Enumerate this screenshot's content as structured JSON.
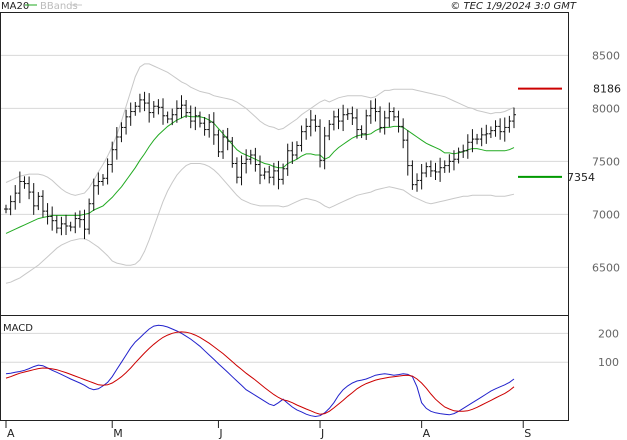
{
  "header": {
    "legend_ma": "MA20",
    "legend_bands": "BBands",
    "timestamp": "© TEC 1/9/2024 3:0 GMT"
  },
  "colors": {
    "ma": "#22aa22",
    "bands": "#c8c8c8",
    "bars": "#111111",
    "resistance": "#cc0000",
    "support": "#009900",
    "macd": "#2222cc",
    "signal": "#cc0000",
    "grid": "#d8d8d8"
  },
  "chart_data": [
    {
      "type": "ohlc",
      "ylim": [
        6050,
        8900
      ],
      "yticks": [
        6500,
        7000,
        7500,
        8000,
        8500
      ],
      "ytick_labels": [
        "6500",
        "7000",
        "7500",
        "8000",
        "8500"
      ],
      "months": [
        "A",
        "M",
        "J",
        "J",
        "A",
        "S"
      ],
      "month_index": [
        0,
        23,
        46,
        68,
        90,
        112
      ],
      "resistance": {
        "value": 8186,
        "label": "8186"
      },
      "support": {
        "value": 7354,
        "label": "7354"
      },
      "close": [
        7050,
        7120,
        7200,
        7310,
        7290,
        7210,
        7080,
        7170,
        7030,
        6980,
        6940,
        6870,
        6910,
        6890,
        6880,
        6960,
        6950,
        6860,
        7100,
        7270,
        7310,
        7340,
        7470,
        7610,
        7730,
        7820,
        7920,
        7970,
        8020,
        8080,
        8050,
        7960,
        8020,
        8010,
        7930,
        7900,
        7940,
        8000,
        8030,
        7960,
        7880,
        7930,
        7860,
        7800,
        7870,
        7750,
        7590,
        7730,
        7690,
        7480,
        7350,
        7480,
        7520,
        7560,
        7470,
        7370,
        7400,
        7350,
        7410,
        7330,
        7430,
        7600,
        7560,
        7650,
        7780,
        7830,
        7890,
        7830,
        7510,
        7740,
        7850,
        7920,
        7880,
        7940,
        7950,
        7910,
        7800,
        7760,
        7930,
        8000,
        7970,
        7820,
        7910,
        7970,
        7920,
        7830,
        7700,
        7460,
        7280,
        7320,
        7390,
        7450,
        7410,
        7400,
        7440,
        7460,
        7500,
        7520,
        7590,
        7600,
        7680,
        7710,
        7710,
        7750,
        7760,
        7790,
        7830,
        7780,
        7820,
        7880,
        7940
      ],
      "ma20": [
        6820,
        6840,
        6860,
        6880,
        6900,
        6920,
        6940,
        6960,
        6970,
        6980,
        6990,
        6990,
        6990,
        6990,
        6990,
        6990,
        6990,
        7000,
        7010,
        7040,
        7060,
        7080,
        7120,
        7160,
        7210,
        7260,
        7320,
        7380,
        7440,
        7510,
        7570,
        7640,
        7700,
        7750,
        7790,
        7830,
        7860,
        7890,
        7910,
        7930,
        7920,
        7920,
        7920,
        7910,
        7890,
        7860,
        7810,
        7760,
        7710,
        7660,
        7610,
        7580,
        7560,
        7540,
        7520,
        7500,
        7480,
        7470,
        7450,
        7440,
        7440,
        7480,
        7500,
        7520,
        7550,
        7570,
        7570,
        7560,
        7560,
        7520,
        7540,
        7590,
        7630,
        7660,
        7690,
        7720,
        7740,
        7750,
        7750,
        7760,
        7790,
        7810,
        7820,
        7820,
        7830,
        7830,
        7820,
        7790,
        7760,
        7730,
        7700,
        7670,
        7650,
        7630,
        7610,
        7580,
        7580,
        7570,
        7580,
        7590,
        7610,
        7620,
        7620,
        7610,
        7600,
        7600,
        7600,
        7600,
        7600,
        7610,
        7630
      ],
      "upper_band": [
        7300,
        7320,
        7340,
        7360,
        7370,
        7380,
        7380,
        7380,
        7370,
        7350,
        7320,
        7280,
        7240,
        7210,
        7190,
        7180,
        7190,
        7200,
        7250,
        7320,
        7400,
        7470,
        7550,
        7640,
        7750,
        7880,
        8020,
        8160,
        8300,
        8390,
        8420,
        8420,
        8400,
        8380,
        8360,
        8340,
        8310,
        8280,
        8250,
        8230,
        8200,
        8180,
        8160,
        8150,
        8140,
        8120,
        8110,
        8100,
        8090,
        8080,
        8060,
        8030,
        8000,
        7960,
        7920,
        7880,
        7850,
        7830,
        7820,
        7800,
        7810,
        7840,
        7870,
        7900,
        7940,
        7970,
        8000,
        8030,
        8060,
        8080,
        8060,
        8080,
        8100,
        8110,
        8120,
        8120,
        8120,
        8120,
        8110,
        8100,
        8110,
        8140,
        8170,
        8170,
        8180,
        8180,
        8180,
        8180,
        8180,
        8170,
        8160,
        8150,
        8140,
        8130,
        8120,
        8110,
        8090,
        8070,
        8050,
        8030,
        8010,
        8000,
        7980,
        7970,
        7960,
        7950,
        7960,
        7960,
        7970,
        7990,
        8010
      ],
      "lower_band": [
        6350,
        6360,
        6380,
        6400,
        6430,
        6460,
        6490,
        6520,
        6560,
        6600,
        6640,
        6680,
        6710,
        6730,
        6750,
        6760,
        6770,
        6770,
        6750,
        6720,
        6690,
        6650,
        6610,
        6560,
        6540,
        6530,
        6520,
        6520,
        6530,
        6570,
        6650,
        6760,
        6880,
        7000,
        7120,
        7220,
        7300,
        7370,
        7420,
        7460,
        7480,
        7480,
        7480,
        7470,
        7450,
        7420,
        7380,
        7330,
        7280,
        7230,
        7180,
        7140,
        7120,
        7100,
        7090,
        7080,
        7080,
        7080,
        7080,
        7080,
        7070,
        7080,
        7100,
        7120,
        7140,
        7150,
        7140,
        7130,
        7110,
        7080,
        7060,
        7080,
        7100,
        7120,
        7140,
        7160,
        7180,
        7190,
        7200,
        7210,
        7230,
        7240,
        7250,
        7260,
        7250,
        7240,
        7230,
        7200,
        7170,
        7150,
        7130,
        7110,
        7100,
        7110,
        7120,
        7130,
        7140,
        7150,
        7160,
        7170,
        7170,
        7180,
        7180,
        7180,
        7180,
        7180,
        7170,
        7170,
        7170,
        7180,
        7190
      ]
    },
    {
      "type": "line",
      "title": "MACD",
      "ylim": [
        -100,
        260
      ],
      "yticks": [
        100,
        200
      ],
      "ytick_labels": [
        "100",
        "200"
      ],
      "series": [
        {
          "values": [
            60,
            62,
            65,
            68,
            72,
            78,
            85,
            90,
            88,
            80,
            72,
            65,
            58,
            50,
            42,
            35,
            28,
            20,
            10,
            5,
            8,
            18,
            30,
            50,
            75,
            100,
            125,
            150,
            170,
            185,
            200,
            215,
            225,
            228,
            226,
            222,
            215,
            208,
            200,
            190,
            180,
            168,
            155,
            140,
            125,
            110,
            95,
            80,
            65,
            50,
            35,
            20,
            5,
            -5,
            -15,
            -25,
            -35,
            -45,
            -50,
            -40,
            -28,
            -42,
            -55,
            -65,
            -72,
            -80,
            -85,
            -88,
            -85,
            -75,
            -60,
            -40,
            -15,
            5,
            18,
            28,
            35,
            38,
            42,
            48,
            55,
            58,
            60,
            58,
            55,
            57,
            60,
            58,
            50,
            15,
            -40,
            -60,
            -70,
            -75,
            -78,
            -80,
            -82,
            -78,
            -70,
            -60,
            -50,
            -40,
            -30,
            -20,
            -10,
            0,
            8,
            15,
            22,
            30,
            42
          ]
        },
        {
          "values": [
            45,
            50,
            56,
            62,
            66,
            70,
            74,
            78,
            80,
            79,
            77,
            74,
            69,
            64,
            58,
            52,
            46,
            40,
            34,
            28,
            22,
            20,
            22,
            28,
            38,
            50,
            64,
            80,
            98,
            115,
            132,
            148,
            162,
            175,
            186,
            194,
            200,
            204,
            205,
            204,
            200,
            194,
            186,
            176,
            166,
            154,
            142,
            130,
            116,
            102,
            88,
            75,
            62,
            50,
            38,
            25,
            12,
            0,
            -12,
            -22,
            -30,
            -34,
            -40,
            -48,
            -55,
            -62,
            -68,
            -75,
            -80,
            -78,
            -70,
            -58,
            -45,
            -32,
            -18,
            -5,
            8,
            18,
            26,
            32,
            38,
            42,
            45,
            48,
            50,
            52,
            54,
            55,
            52,
            42,
            28,
            10,
            -10,
            -28,
            -42,
            -55,
            -62,
            -68,
            -70,
            -70,
            -68,
            -63,
            -56,
            -48,
            -40,
            -32,
            -24,
            -16,
            -8,
            2,
            15
          ]
        }
      ]
    }
  ]
}
